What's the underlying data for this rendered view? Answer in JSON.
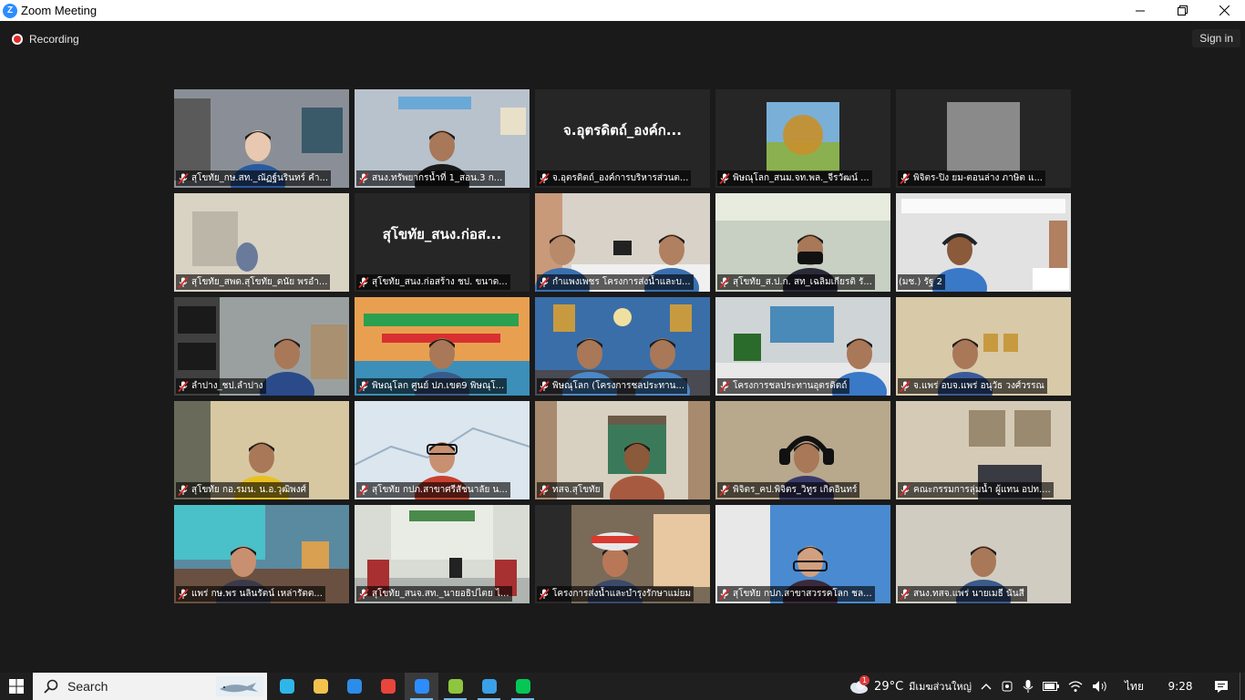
{
  "window": {
    "title": "Zoom Meeting",
    "logo_letter": "Z",
    "minimize_icon": "minimize-icon",
    "maximize_icon": "restore-icon",
    "close_icon": "close-icon"
  },
  "meeting": {
    "recording_label": "Recording",
    "signin_label": "Sign in"
  },
  "participants": [
    {
      "label": "สุโขทัย_กษ.สท._ณัฏฐ์นรินทร์ คำ...",
      "muted": true,
      "scene": "desk",
      "bg": "#8a8f97"
    },
    {
      "label": "สนง.ทรัพยากรน้ำที่ 1_สอน.3 ก...",
      "muted": true,
      "scene": "office",
      "bg": "#b8c2cc"
    },
    {
      "label": "จ.อุตรดิตถ์_องค์การบริหารส่วนต...",
      "muted": true,
      "scene": "name",
      "display_name": "จ.อุตรดิตถ์_องค์ก...",
      "bg": "#262626"
    },
    {
      "label": "พิษณุโลก_สนม.จท.พล._จีรวัฒน์ ...",
      "muted": true,
      "scene": "logo",
      "bg": "#262626"
    },
    {
      "label": "พิจิตร-ปิง ยม-ตอนล่าง ภาษิต แ...",
      "muted": true,
      "scene": "grey",
      "bg": "#262626"
    },
    {
      "label": "สุโขทัย_สพด.สุโขทัย_ดนัย พรอำ...",
      "muted": true,
      "scene": "blur",
      "bg": "#d9d3c4"
    },
    {
      "label": "สุโขทัย_สนง.ก่อสร้าง ชป. ขนาด...",
      "muted": true,
      "scene": "name",
      "display_name": "สุโขทัย_สนง.ก่อส...",
      "bg": "#262626"
    },
    {
      "label": "กำแพงเพชร โครงการส่งน้ำและบ...",
      "muted": true,
      "scene": "meeting",
      "bg": "#d8d2c8"
    },
    {
      "label": "สุโขทัย_ส.ป.ก. สท_เฉลิมเกียรติ รั...",
      "muted": true,
      "scene": "mask",
      "bg": "#c7d0c2"
    },
    {
      "label": "(มช.) รัฐ 2",
      "muted": false,
      "scene": "headset",
      "bg": "#e2e2e2",
      "active": true
    },
    {
      "label": "ลำปาง_ชป.ลำปาง",
      "muted": true,
      "scene": "shelf",
      "bg": "#9aa0a0"
    },
    {
      "label": "พิษณุโลก ศูนย์ ปภ.เขต9 พิษณุโ...",
      "muted": true,
      "scene": "banner",
      "bg": "#3c8fb8"
    },
    {
      "label": "พิษณุโลก (โครงการชลประทาน...",
      "muted": true,
      "scene": "hall",
      "bg": "#3a6ea8"
    },
    {
      "label": "โครงการชลประทานอุตรดิตถ์",
      "muted": true,
      "scene": "room",
      "bg": "#cfd4d6"
    },
    {
      "label": "จ.แพร่ อบจ.แพร่ อนุวัธ วงศ์วรรณ",
      "muted": true,
      "scene": "frames",
      "bg": "#d8c9a8"
    },
    {
      "label": "สุโขทัย กอ.รมน. น.อ.วุฒิพงศ์",
      "muted": true,
      "scene": "wall",
      "bg": "#d7c8a2"
    },
    {
      "label": "สุโขทัย กปภ.สาขาศรีสัชนาลัย น...",
      "muted": true,
      "scene": "map",
      "bg": "#c8d8e6"
    },
    {
      "label": "ทสจ.สุโขทัย",
      "muted": true,
      "scene": "window",
      "bg": "#a88a6e"
    },
    {
      "label": "พิจิตร_คป.พิจิตร_วิทูร เกิดอินทร์",
      "muted": true,
      "scene": "headphones",
      "bg": "#b8a88c"
    },
    {
      "label": "คณะกรรมการลุ่มน้ำ ผู้แทน อปท....",
      "muted": true,
      "scene": "chair",
      "bg": "#d4cab6"
    },
    {
      "label": "แพร่ กษ.พร นลินรัตน์ เหล่ารัตต...",
      "muted": true,
      "scene": "cubicle",
      "bg": "#5a8aa0"
    },
    {
      "label": "สุโขทัย_สนจ.สท._นายอธิปไตย ไ...",
      "muted": true,
      "scene": "stage",
      "bg": "#d8dcd4"
    },
    {
      "label": "โครงการส่งน้ำและบำรุงรักษาแม่ยม",
      "muted": true,
      "scene": "car",
      "bg": "#7a6a58"
    },
    {
      "label": "สุโขทัย กปภ.สาขาสวรรคโลก ชล...",
      "muted": true,
      "scene": "blinds",
      "bg": "#4a8ad0"
    },
    {
      "label": "สนง.ทสจ.แพร่ นายเมธี นันสี",
      "muted": true,
      "scene": "man",
      "bg": "#cfcac0"
    }
  ],
  "taskbar": {
    "search_label": "Search",
    "apps": [
      {
        "name": "edge-icon",
        "color": "#2fb6e8",
        "running": false
      },
      {
        "name": "file-explorer-icon",
        "color": "#f2c14e",
        "running": false
      },
      {
        "name": "mail-icon",
        "color": "#2c8ce8",
        "running": false
      },
      {
        "name": "chrome-icon",
        "color": "#e8453c",
        "running": false
      },
      {
        "name": "zoom-icon",
        "color": "#2d8cff",
        "running": true,
        "focused": true
      },
      {
        "name": "qgis-icon",
        "color": "#8ec63f",
        "running": true
      },
      {
        "name": "app-icon",
        "color": "#3aa0e8",
        "running": true
      },
      {
        "name": "line-icon",
        "color": "#06c755",
        "running": true
      }
    ],
    "weather_temp": "29°C",
    "weather_text": "มีเมฆส่วนใหญ่",
    "weather_badge": "1",
    "language": "ไทย",
    "time": "9:28"
  }
}
